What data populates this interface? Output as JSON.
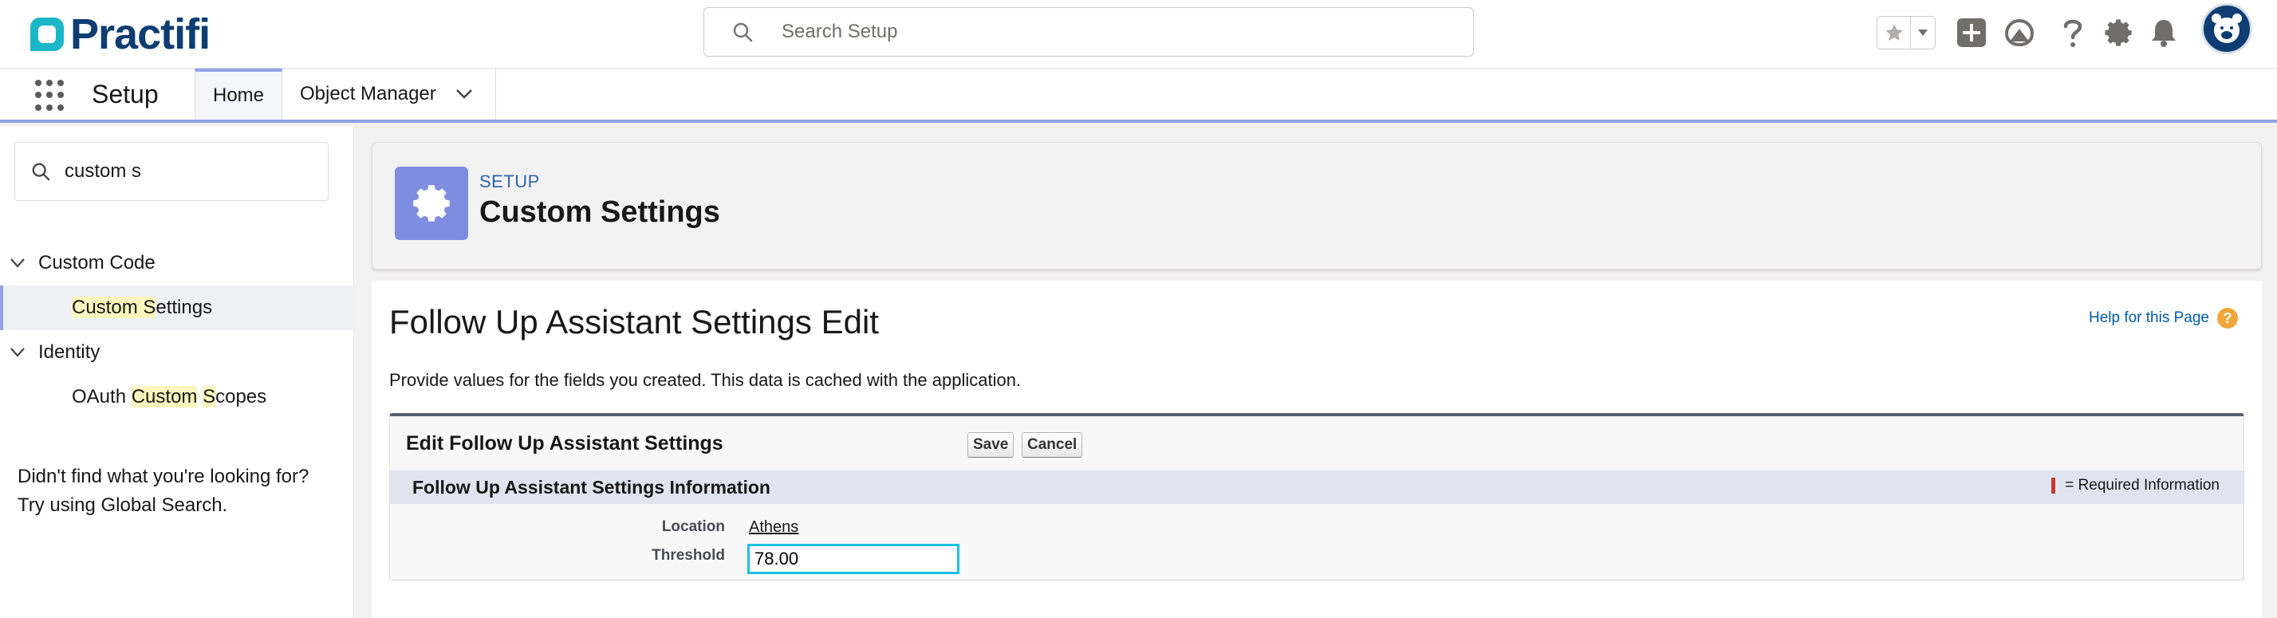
{
  "header": {
    "brand": "Practifi",
    "search_placeholder": "Search Setup",
    "icons": [
      "star-icon",
      "chevron-down-icon",
      "plus-icon",
      "trailhead-icon",
      "help-icon",
      "gear-icon",
      "bell-icon",
      "avatar-icon"
    ]
  },
  "app_nav": {
    "app_name": "Setup",
    "tabs": [
      {
        "label": "Home",
        "active": true
      },
      {
        "label": "Object Manager",
        "active": false
      }
    ]
  },
  "sidebar": {
    "quick_find_value": "custom s",
    "tree": [
      {
        "label": "Custom Code",
        "expanded": true,
        "children": [
          {
            "label_parts": [
              "",
              "Custom S",
              "ettings"
            ],
            "selected": true
          }
        ]
      },
      {
        "label": "Identity",
        "expanded": true,
        "children": [
          {
            "label_parts": [
              "OAuth ",
              "Custom",
              " ",
              "S",
              "copes"
            ],
            "selected": false
          }
        ]
      }
    ],
    "not_found_line1": "Didn't find what you're looking for?",
    "not_found_line2": "Try using Global Search."
  },
  "setup_header": {
    "eyebrow": "SETUP",
    "title": "Custom Settings"
  },
  "content": {
    "page_title": "Follow Up Assistant Settings Edit",
    "help_link": "Help for this Page",
    "help_icon_glyph": "?",
    "description": "Provide values for the fields you created. This data is cached with the application.",
    "block_title": "Edit Follow Up Assistant Settings",
    "save_label": "Save",
    "cancel_label": "Cancel",
    "section_title": "Follow Up Assistant Settings Information",
    "required_legend": "= Required Information",
    "fields": {
      "location_label": "Location",
      "location_value": "Athens",
      "threshold_label": "Threshold",
      "threshold_value": "78.00"
    }
  },
  "colors": {
    "brand": "#0e3d73",
    "accent": "#8fa3e6",
    "setup_icon_bg": "#7f8de1",
    "link": "#015ba7",
    "required": "#c23934",
    "highlight": "#fbf6bd"
  }
}
